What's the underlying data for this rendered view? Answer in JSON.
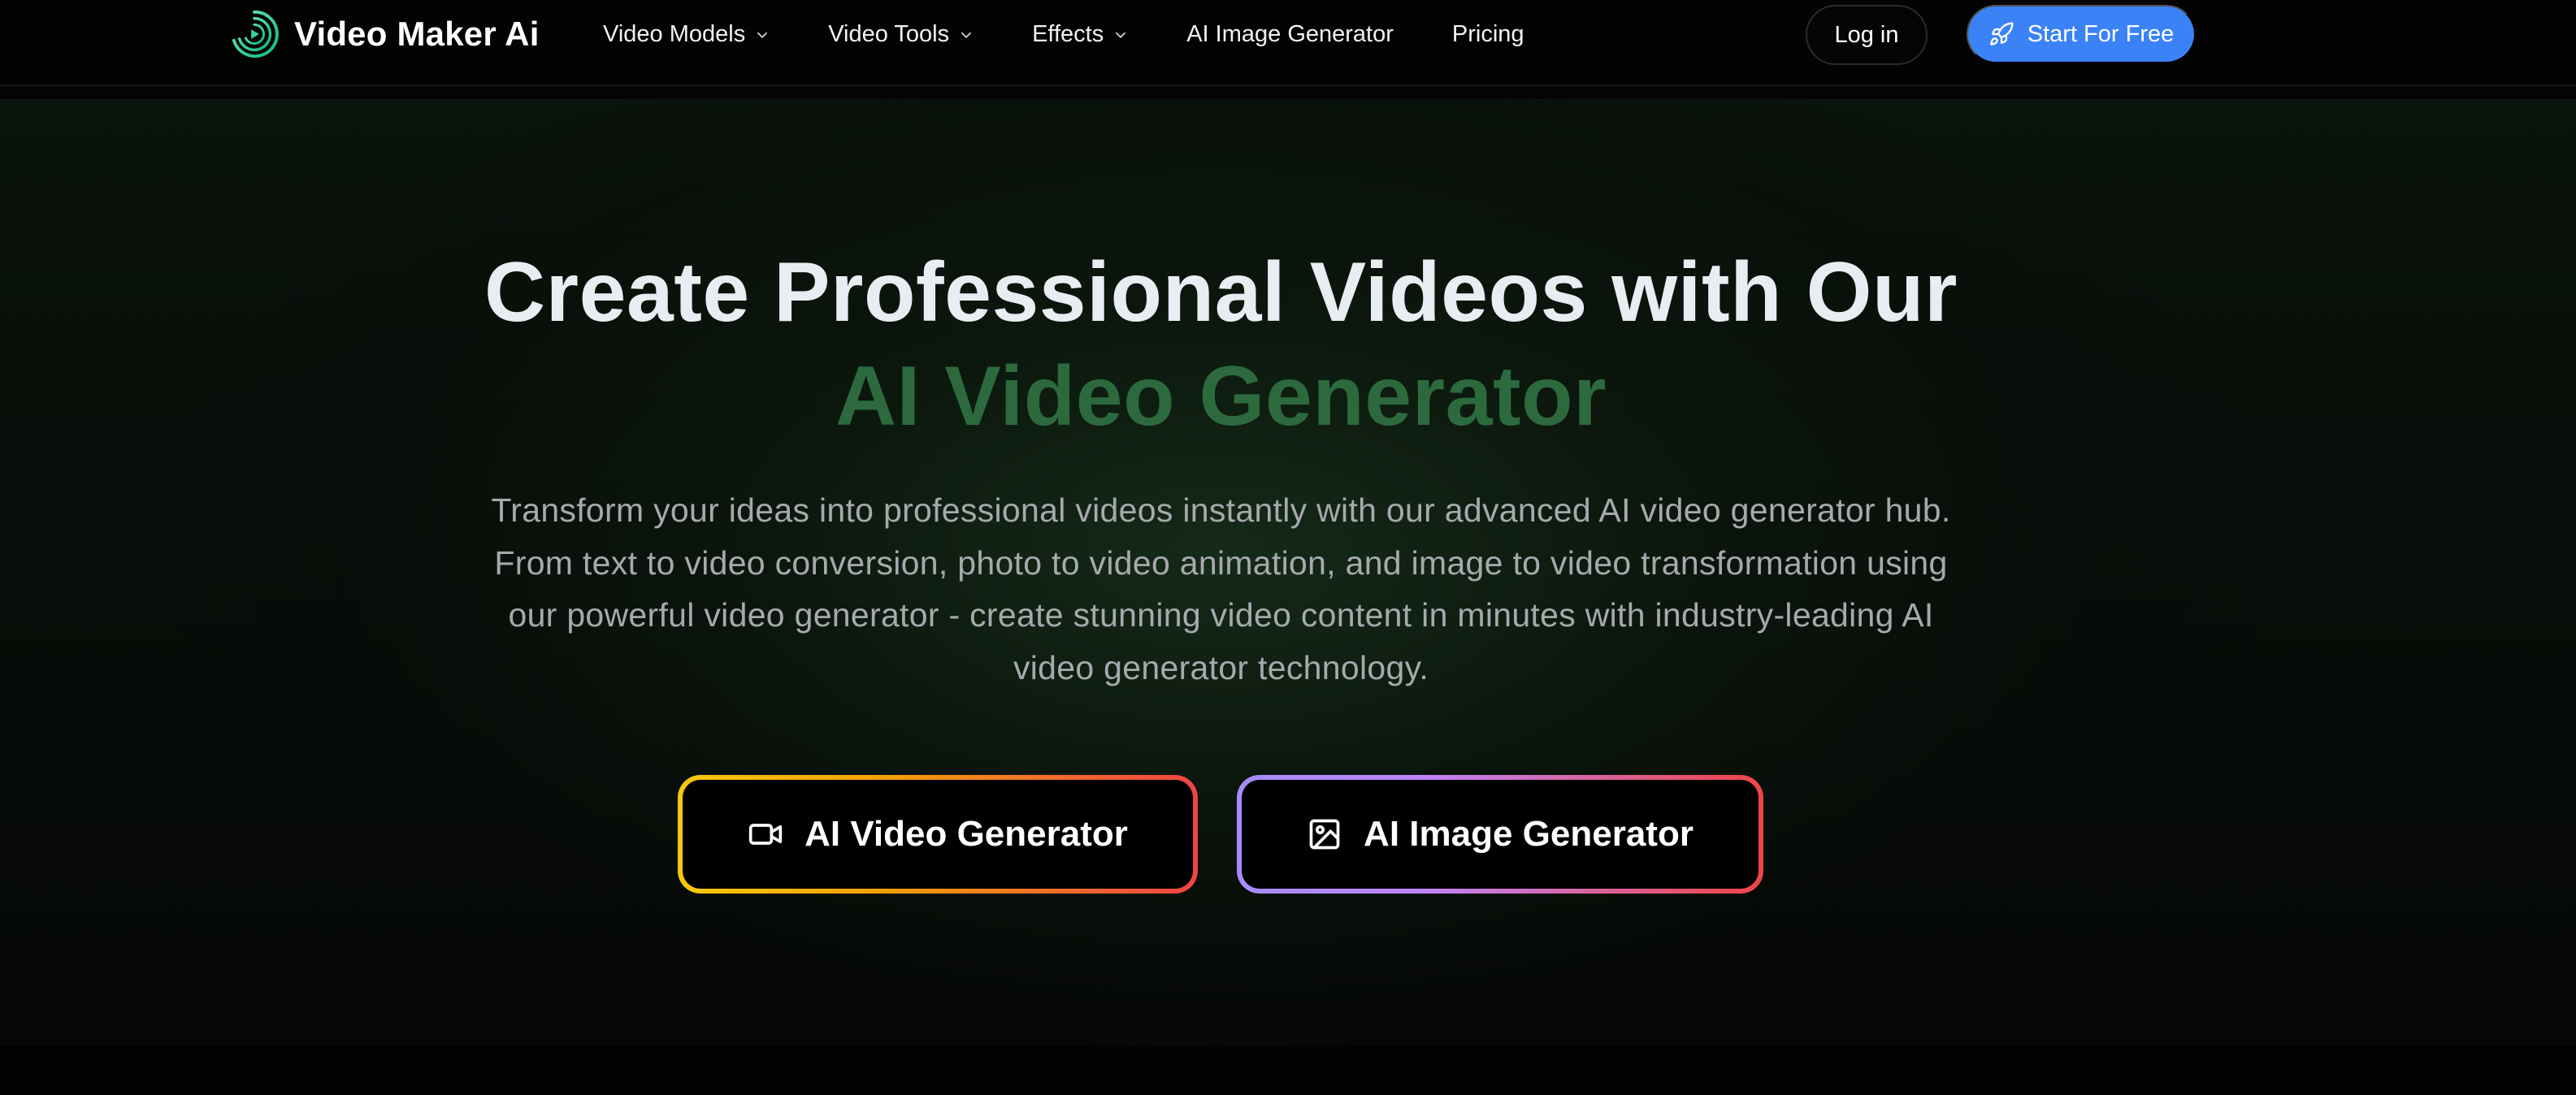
{
  "brand": {
    "name": "Video Maker Ai",
    "logo_icon": "concentric-play-icon",
    "logo_color": "#34d399"
  },
  "nav": {
    "items": [
      {
        "label": "Video Models",
        "has_dropdown": true
      },
      {
        "label": "Video Tools",
        "has_dropdown": true
      },
      {
        "label": "Effects",
        "has_dropdown": true
      },
      {
        "label": "AI Image Generator",
        "has_dropdown": false
      },
      {
        "label": "Pricing",
        "has_dropdown": false
      }
    ],
    "login_label": "Log in",
    "start_label": "Start For Free",
    "start_icon": "rocket-icon",
    "start_color": "#3b82f6"
  },
  "hero": {
    "title_line1": "Create Professional Videos with Our",
    "title_line2": "AI Video Generator",
    "accent_color": "#2c6a3e",
    "description": "Transform your ideas into professional videos instantly with our advanced AI video generator hub. From text to video conversion, photo to video animation, and image to video transformation using our powerful video generator - create stunning video content in minutes with industry-leading AI video generator technology.",
    "cta_video_label": "AI Video Generator",
    "cta_video_icon": "video-camera-icon",
    "cta_image_label": "AI Image Generator",
    "cta_image_icon": "image-icon"
  }
}
